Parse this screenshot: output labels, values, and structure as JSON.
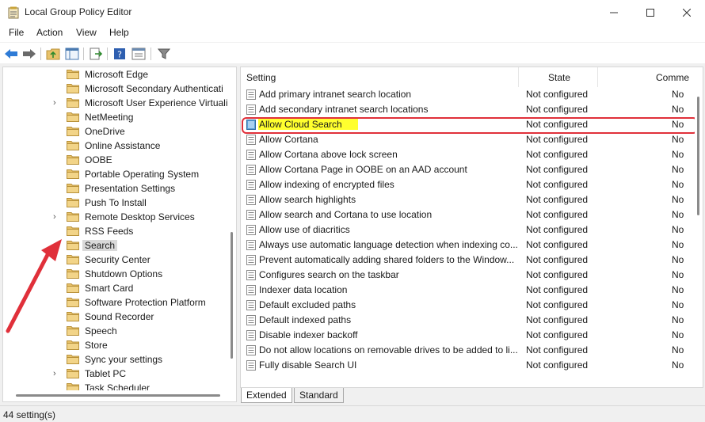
{
  "window": {
    "title": "Local Group Policy Editor",
    "icons": {
      "app": "policy-editor-icon",
      "minimize": "minimize-icon",
      "maximize": "maximize-icon",
      "close": "close-icon"
    }
  },
  "menu": {
    "items": [
      "File",
      "Action",
      "View",
      "Help"
    ]
  },
  "toolbar": {
    "buttons": [
      "back-arrow-icon",
      "forward-arrow-icon",
      "up-folder-icon",
      "show-hide-tree-icon",
      "export-list-icon",
      "help-icon",
      "properties-icon",
      "filter-icon"
    ]
  },
  "tree": {
    "items": [
      {
        "label": "Microsoft Edge",
        "expandable": false
      },
      {
        "label": "Microsoft Secondary Authenticati",
        "expandable": false
      },
      {
        "label": "Microsoft User Experience Virtuali",
        "expandable": true
      },
      {
        "label": "NetMeeting",
        "expandable": false
      },
      {
        "label": "OneDrive",
        "expandable": false
      },
      {
        "label": "Online Assistance",
        "expandable": false
      },
      {
        "label": "OOBE",
        "expandable": false
      },
      {
        "label": "Portable Operating System",
        "expandable": false
      },
      {
        "label": "Presentation Settings",
        "expandable": false
      },
      {
        "label": "Push To Install",
        "expandable": false
      },
      {
        "label": "Remote Desktop Services",
        "expandable": true
      },
      {
        "label": "RSS Feeds",
        "expandable": false
      },
      {
        "label": "Search",
        "expandable": false,
        "selected": true
      },
      {
        "label": "Security Center",
        "expandable": false
      },
      {
        "label": "Shutdown Options",
        "expandable": false
      },
      {
        "label": "Smart Card",
        "expandable": false
      },
      {
        "label": "Software Protection Platform",
        "expandable": false
      },
      {
        "label": "Sound Recorder",
        "expandable": false
      },
      {
        "label": "Speech",
        "expandable": false
      },
      {
        "label": "Store",
        "expandable": false
      },
      {
        "label": "Sync your settings",
        "expandable": false
      },
      {
        "label": "Tablet PC",
        "expandable": true
      },
      {
        "label": "Task Scheduler",
        "expandable": false
      }
    ],
    "expander_glyph": "›"
  },
  "settings": {
    "columns": {
      "setting": "Setting",
      "state": "State",
      "comment": "Comme"
    },
    "rows": [
      {
        "name": "Add primary intranet search location",
        "state": "Not configured",
        "comment": "No"
      },
      {
        "name": "Add secondary intranet search locations",
        "state": "Not configured",
        "comment": "No"
      },
      {
        "name": "Allow Cloud Search",
        "state": "Not configured",
        "comment": "No",
        "highlighted": true
      },
      {
        "name": "Allow Cortana",
        "state": "Not configured",
        "comment": "No"
      },
      {
        "name": "Allow Cortana above lock screen",
        "state": "Not configured",
        "comment": "No"
      },
      {
        "name": "Allow Cortana Page in OOBE on an AAD account",
        "state": "Not configured",
        "comment": "No"
      },
      {
        "name": "Allow indexing of encrypted files",
        "state": "Not configured",
        "comment": "No"
      },
      {
        "name": "Allow search highlights",
        "state": "Not configured",
        "comment": "No"
      },
      {
        "name": "Allow search and Cortana to use location",
        "state": "Not configured",
        "comment": "No"
      },
      {
        "name": "Allow use of diacritics",
        "state": "Not configured",
        "comment": "No"
      },
      {
        "name": "Always use automatic language detection when indexing co...",
        "state": "Not configured",
        "comment": "No"
      },
      {
        "name": "Prevent automatically adding shared folders to the Window...",
        "state": "Not configured",
        "comment": "No"
      },
      {
        "name": "Configures search on the taskbar",
        "state": "Not configured",
        "comment": "No"
      },
      {
        "name": "Indexer data location",
        "state": "Not configured",
        "comment": "No"
      },
      {
        "name": "Default excluded paths",
        "state": "Not configured",
        "comment": "No"
      },
      {
        "name": "Default indexed paths",
        "state": "Not configured",
        "comment": "No"
      },
      {
        "name": "Disable indexer backoff",
        "state": "Not configured",
        "comment": "No"
      },
      {
        "name": "Do not allow locations on removable drives to be added to li...",
        "state": "Not configured",
        "comment": "No"
      },
      {
        "name": "Fully disable Search UI",
        "state": "Not configured",
        "comment": "No"
      }
    ]
  },
  "tabs": {
    "extended": "Extended",
    "standard": "Standard"
  },
  "status": {
    "text": "44 setting(s)"
  },
  "colors": {
    "highlight": "#ffff2e",
    "annotation_red": "#e0303a",
    "selection": "#d9d9d9",
    "folder": "#e8c26a"
  }
}
